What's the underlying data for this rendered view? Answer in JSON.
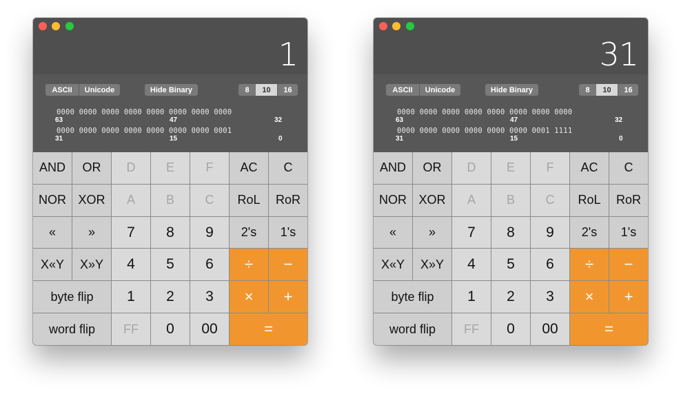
{
  "windows": [
    {
      "display_value": "1",
      "encoding_buttons": [
        "ASCII",
        "Unicode"
      ],
      "hide_binary_label": "Hide Binary",
      "base_buttons": [
        "8",
        "10",
        "16"
      ],
      "selected_base": "10",
      "binary_top": "0000 0000 0000 0000 0000 0000 0000 0000",
      "binary_bottom": "0000 0000 0000 0000 0000 0000 0000 0001",
      "bit_labels_top": [
        "63",
        "47",
        "32"
      ],
      "bit_labels_bottom": [
        "31",
        "15",
        "0"
      ]
    },
    {
      "display_value": "31",
      "encoding_buttons": [
        "ASCII",
        "Unicode"
      ],
      "hide_binary_label": "Hide Binary",
      "base_buttons": [
        "8",
        "10",
        "16"
      ],
      "selected_base": "10",
      "binary_top": "0000 0000 0000 0000 0000 0000 0000 0000",
      "binary_bottom": "0000 0000 0000 0000 0000 0000 0001 1111",
      "bit_labels_top": [
        "63",
        "47",
        "32"
      ],
      "bit_labels_bottom": [
        "31",
        "15",
        "0"
      ]
    }
  ],
  "keys": [
    {
      "label": "AND",
      "style": "dark"
    },
    {
      "label": "OR",
      "style": "dark"
    },
    {
      "label": "D",
      "style": "disabled"
    },
    {
      "label": "E",
      "style": "disabled"
    },
    {
      "label": "F",
      "style": "disabled"
    },
    {
      "label": "AC",
      "style": "dark"
    },
    {
      "label": "C",
      "style": "dark"
    },
    {
      "label": "NOR",
      "style": "dark"
    },
    {
      "label": "XOR",
      "style": "dark"
    },
    {
      "label": "A",
      "style": "disabled"
    },
    {
      "label": "B",
      "style": "disabled"
    },
    {
      "label": "C",
      "style": "disabled"
    },
    {
      "label": "RoL",
      "style": "dark"
    },
    {
      "label": "RoR",
      "style": "dark"
    },
    {
      "label": "«",
      "style": "dark"
    },
    {
      "label": "»",
      "style": "dark"
    },
    {
      "label": "7",
      "style": "digit"
    },
    {
      "label": "8",
      "style": "digit"
    },
    {
      "label": "9",
      "style": "digit"
    },
    {
      "label": "2's",
      "style": "dark"
    },
    {
      "label": "1's",
      "style": "dark"
    },
    {
      "label": "X«Y",
      "style": "dark"
    },
    {
      "label": "X»Y",
      "style": "dark"
    },
    {
      "label": "4",
      "style": "digit"
    },
    {
      "label": "5",
      "style": "digit"
    },
    {
      "label": "6",
      "style": "digit"
    },
    {
      "label": "÷",
      "style": "op"
    },
    {
      "label": "−",
      "style": "op"
    },
    {
      "label": "byte flip",
      "style": "dark",
      "span": 2
    },
    {
      "label": "1",
      "style": "digit"
    },
    {
      "label": "2",
      "style": "digit"
    },
    {
      "label": "3",
      "style": "digit"
    },
    {
      "label": "×",
      "style": "op"
    },
    {
      "label": "+",
      "style": "op"
    },
    {
      "label": "word flip",
      "style": "dark",
      "span": 2
    },
    {
      "label": "FF",
      "style": "disabled"
    },
    {
      "label": "0",
      "style": "digit"
    },
    {
      "label": "00",
      "style": "digit"
    },
    {
      "label": "=",
      "style": "op",
      "span": 2
    }
  ],
  "colors": {
    "operator_orange": "#f1962f",
    "window_dark": "#4f4f4f",
    "key_light": "#dadada"
  }
}
